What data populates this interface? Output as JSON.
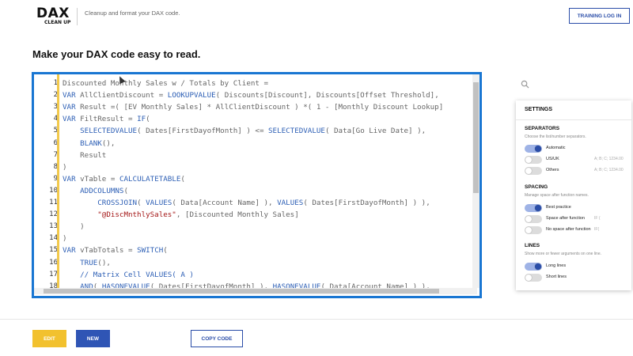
{
  "header": {
    "logo_main": "DAX",
    "logo_sub": "CLEAN UP",
    "tagline": "Cleanup and format your DAX code.",
    "training_button": "TRAINING LOG IN"
  },
  "page_title": "Make your DAX code easy to read.",
  "editor": {
    "line_numbers": [
      "1",
      "2",
      "3",
      "4",
      "5",
      "6",
      "7",
      "8",
      "9",
      "10",
      "11",
      "12",
      "13",
      "14",
      "15",
      "16",
      "17",
      "18"
    ],
    "lines": [
      [
        {
          "t": "Discounted Monthly Sales w / Totals by Client =",
          "c": ""
        }
      ],
      [
        {
          "t": "VAR",
          "c": "kw"
        },
        {
          "t": " AllClientDiscount = ",
          "c": ""
        },
        {
          "t": "LOOKUPVALUE",
          "c": "fn"
        },
        {
          "t": "( Discounts[Discount], Discounts[Offset Threshold],",
          "c": ""
        }
      ],
      [
        {
          "t": "VAR",
          "c": "kw"
        },
        {
          "t": " Result =( [EV Monthly Sales] * AllClientDiscount ) *( 1 - [Monthly Discount Lookup]",
          "c": ""
        }
      ],
      [
        {
          "t": "VAR",
          "c": "kw"
        },
        {
          "t": " FiltResult = ",
          "c": ""
        },
        {
          "t": "IF",
          "c": "fn"
        },
        {
          "t": "(",
          "c": ""
        }
      ],
      [
        {
          "t": "    ",
          "c": ""
        },
        {
          "t": "SELECTEDVALUE",
          "c": "fn"
        },
        {
          "t": "( Dates[FirstDayofMonth] ) <= ",
          "c": ""
        },
        {
          "t": "SELECTEDVALUE",
          "c": "fn"
        },
        {
          "t": "( Data[Go Live Date] ),",
          "c": ""
        }
      ],
      [
        {
          "t": "    ",
          "c": ""
        },
        {
          "t": "BLANK",
          "c": "fn"
        },
        {
          "t": "(),",
          "c": ""
        }
      ],
      [
        {
          "t": "    Result",
          "c": ""
        }
      ],
      [
        {
          "t": ")",
          "c": ""
        }
      ],
      [
        {
          "t": "VAR",
          "c": "kw"
        },
        {
          "t": " vTable = ",
          "c": ""
        },
        {
          "t": "CALCULATETABLE",
          "c": "fn"
        },
        {
          "t": "(",
          "c": ""
        }
      ],
      [
        {
          "t": "    ",
          "c": ""
        },
        {
          "t": "ADDCOLUMNS",
          "c": "fn"
        },
        {
          "t": "(",
          "c": ""
        }
      ],
      [
        {
          "t": "        ",
          "c": ""
        },
        {
          "t": "CROSSJOIN",
          "c": "fn"
        },
        {
          "t": "( ",
          "c": ""
        },
        {
          "t": "VALUES",
          "c": "fn"
        },
        {
          "t": "( Data[Account Name] ), ",
          "c": ""
        },
        {
          "t": "VALUES",
          "c": "fn"
        },
        {
          "t": "( Dates[FirstDayofMonth] ) ),",
          "c": ""
        }
      ],
      [
        {
          "t": "        ",
          "c": ""
        },
        {
          "t": "\"@DiscMnthlySales\"",
          "c": "str"
        },
        {
          "t": ", [Discounted Monthly Sales]",
          "c": ""
        }
      ],
      [
        {
          "t": "    )",
          "c": ""
        }
      ],
      [
        {
          "t": ")",
          "c": ""
        }
      ],
      [
        {
          "t": "VAR",
          "c": "kw"
        },
        {
          "t": " vTabTotals = ",
          "c": ""
        },
        {
          "t": "SWITCH",
          "c": "fn"
        },
        {
          "t": "(",
          "c": ""
        }
      ],
      [
        {
          "t": "    ",
          "c": ""
        },
        {
          "t": "TRUE",
          "c": "fn"
        },
        {
          "t": "(),",
          "c": ""
        }
      ],
      [
        {
          "t": "    ",
          "c": ""
        },
        {
          "t": "// Matrix Cell VALUES( A )",
          "c": "cmt"
        }
      ],
      [
        {
          "t": "    ",
          "c": ""
        },
        {
          "t": "AND",
          "c": "fn"
        },
        {
          "t": "( ",
          "c": ""
        },
        {
          "t": "HASONEVALUE",
          "c": "fn"
        },
        {
          "t": "( Dates[FirstDayofMonth] ), ",
          "c": ""
        },
        {
          "t": "HASONEVALUE",
          "c": "fn"
        },
        {
          "t": "( Data[Account Name] ) ),",
          "c": ""
        }
      ]
    ]
  },
  "settings": {
    "title": "SETTINGS",
    "separators": {
      "title": "SEPARATORS",
      "desc": "Choose the list/number separators.",
      "options": [
        {
          "label": "Automatic",
          "example": "",
          "on": true
        },
        {
          "label": "US/UK",
          "example": "A; B; C; 1234.00",
          "on": false
        },
        {
          "label": "Others",
          "example": "A; B; C; 1234.00",
          "on": false
        }
      ]
    },
    "spacing": {
      "title": "SPACING",
      "desc": "Manage space after function names.",
      "options": [
        {
          "label": "Best practice",
          "example": "",
          "on": true
        },
        {
          "label": "Space after function",
          "example": "IF (",
          "on": false
        },
        {
          "label": "No space after function",
          "example": "IF(",
          "on": false
        }
      ]
    },
    "lines": {
      "title": "LINES",
      "desc": "Show more or fewer arguments on one line.",
      "options": [
        {
          "label": "Long lines",
          "example": "",
          "on": true
        },
        {
          "label": "Short lines",
          "example": "",
          "on": false
        }
      ]
    }
  },
  "footer": {
    "edit": "EDIT",
    "new": "NEW",
    "copy": "COPY CODE"
  },
  "colors": {
    "accent_blue": "#2a4da8",
    "editor_border": "#1976d2",
    "edit_yellow": "#f2c12e",
    "gutter_yellow": "#f2c94c"
  }
}
